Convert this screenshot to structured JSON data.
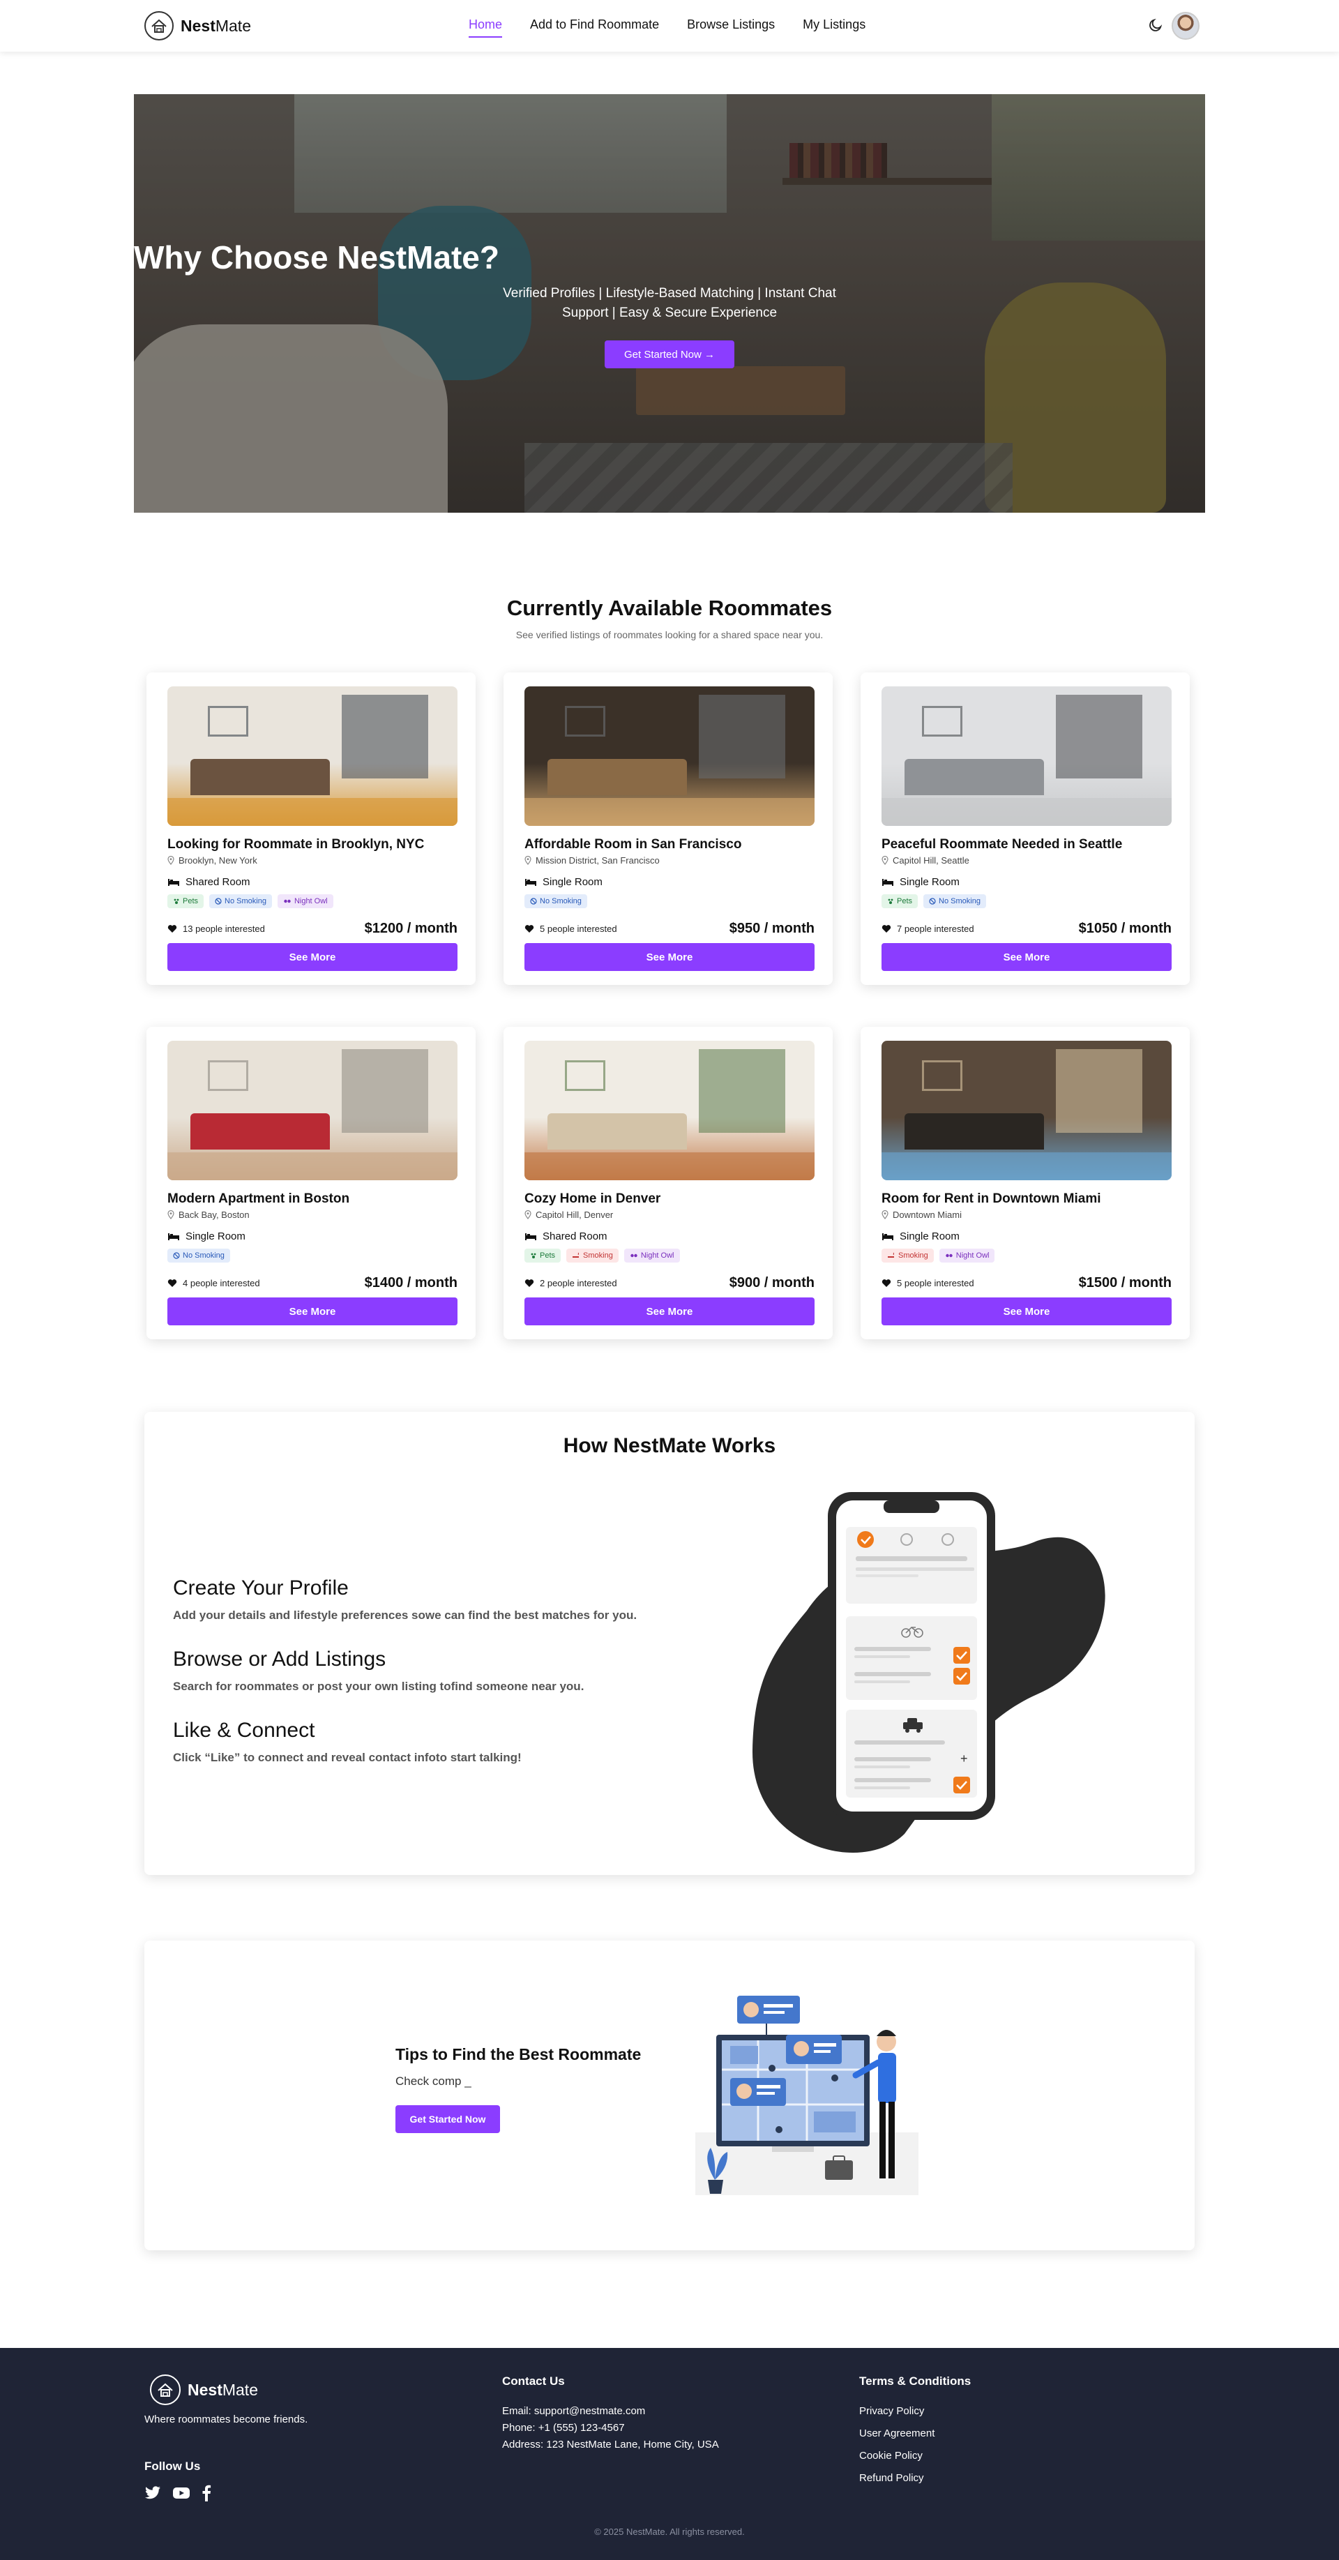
{
  "nav": {
    "brand_bold": "Nest",
    "brand_light": "Mate",
    "links": [
      "Home",
      "Add to Find Roommate",
      "Browse Listings",
      "My Listings"
    ],
    "active": "Home"
  },
  "hero": {
    "title": "Why Choose NestMate?",
    "subtitle": "Verified Profiles | Lifestyle-Based Matching | Instant Chat Support | Easy & Secure Experience",
    "button": "Get Started Now →"
  },
  "roommates": {
    "title": "Currently Available Roommates",
    "subtitle": "See verified listings of roommates looking for a shared space near you.",
    "cards": [
      {
        "title": "Looking for Roommate in Brooklyn, NYC",
        "location": "Brooklyn, New York",
        "room_type": "Shared Room",
        "tags": [
          {
            "label": "Pets",
            "color": "green"
          },
          {
            "label": "No Smoking",
            "color": "blue"
          },
          {
            "label": "Night Owl",
            "color": "purple"
          }
        ],
        "interested": "13 people interested",
        "price": "$1200 / month",
        "button": "See More"
      },
      {
        "title": "Affordable Room in San Francisco",
        "location": "Mission District, San Francisco",
        "room_type": "Single Room",
        "tags": [
          {
            "label": "No Smoking",
            "color": "blue"
          }
        ],
        "interested": "5 people interested",
        "price": "$950 / month",
        "button": "See More"
      },
      {
        "title": "Peaceful Roommate Needed in Seattle",
        "location": "Capitol Hill, Seattle",
        "room_type": "Single Room",
        "tags": [
          {
            "label": "Pets",
            "color": "green"
          },
          {
            "label": "No Smoking",
            "color": "blue"
          }
        ],
        "interested": "7 people interested",
        "price": "$1050 / month",
        "button": "See More"
      },
      {
        "title": "Modern Apartment in Boston",
        "location": "Back Bay, Boston",
        "room_type": "Single Room",
        "tags": [
          {
            "label": "No Smoking",
            "color": "blue"
          }
        ],
        "interested": "4 people interested",
        "price": "$1400 / month",
        "button": "See More"
      },
      {
        "title": "Cozy Home in Denver",
        "location": "Capitol Hill, Denver",
        "room_type": "Shared Room",
        "tags": [
          {
            "label": "Pets",
            "color": "green"
          },
          {
            "label": "Smoking",
            "color": "red"
          },
          {
            "label": "Night Owl",
            "color": "purple"
          }
        ],
        "interested": "2 people interested",
        "price": "$900 / month",
        "button": "See More"
      },
      {
        "title": "Room for Rent in Downtown Miami",
        "location": "Downtown Miami",
        "room_type": "Single Room",
        "tags": [
          {
            "label": "Smoking",
            "color": "red"
          },
          {
            "label": "Night Owl",
            "color": "purple"
          }
        ],
        "interested": "5 people interested",
        "price": "$1500 / month",
        "button": "See More"
      }
    ]
  },
  "how": {
    "title": "How NestMate Works",
    "steps": [
      {
        "title": "Create Your Profile",
        "desc": "Add your details and lifestyle preferences sowe can find the best matches for you."
      },
      {
        "title": "Browse or Add Listings",
        "desc": "Search for roommates or post your own listing tofind someone near you."
      },
      {
        "title": "Like & Connect",
        "desc": "Click “Like” to connect and reveal contact infoto start talking!"
      }
    ]
  },
  "tips": {
    "title": "Tips to Find the Best Roommate",
    "text": "Check comp _",
    "button": "Get Started Now"
  },
  "footer": {
    "brand_bold": "Nest",
    "brand_light": "Mate",
    "tagline": "Where roommates become friends.",
    "follow": "Follow Us",
    "contact_title": "Contact Us",
    "email": "Email: support@nestmate.com",
    "phone": "Phone: +1 (555) 123-4567",
    "address": "Address: 123 NestMate Lane, Home City, USA",
    "terms_title": "Terms & Conditions",
    "terms_links": [
      "Privacy Policy",
      "User Agreement",
      "Cookie Policy",
      "Refund Policy"
    ],
    "copyright": "© 2025 NestMate. All rights reserved."
  },
  "colors": {
    "accent": "#8b3dff",
    "footer_bg": "#1f2436",
    "orange": "#f07a1a"
  },
  "icons": [
    "moon-icon",
    "location-pin-icon",
    "bed-icon",
    "heart-icon",
    "paw-icon",
    "no-smoking-icon",
    "night-owl-icon",
    "smoking-icon",
    "twitter-icon",
    "youtube-icon",
    "facebook-icon",
    "bicycle-icon",
    "car-icon"
  ]
}
